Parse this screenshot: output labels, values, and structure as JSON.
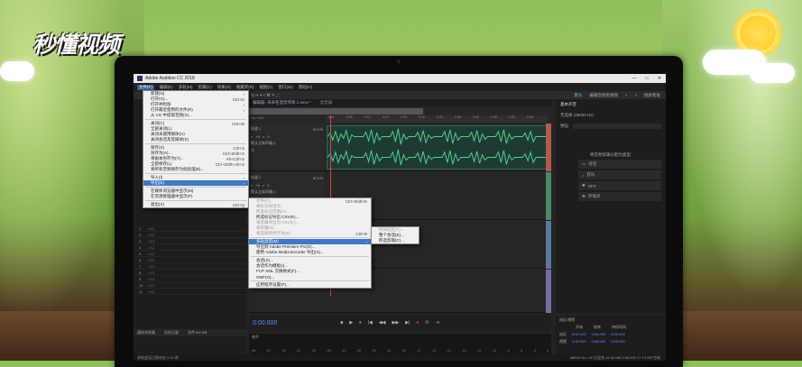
{
  "watermark": "秒懂视频",
  "window": {
    "title": "Adobe Audition CC 2018",
    "controls": [
      "—",
      "□",
      "✕"
    ]
  },
  "menubar": [
    "文件(F)",
    "编辑(E)",
    "多轨(M)",
    "剪辑(C)",
    "效果(S)",
    "收藏夹(R)",
    "视图(V)",
    "窗口(W)",
    "帮助(H)"
  ],
  "toolbar": {
    "workspace": "默认",
    "edit_audio": "编辑音频到视频",
    "more": "»",
    "search_placeholder": "搜索帮助"
  },
  "editor": {
    "tab": "编辑器: 未命名混音项目 1.sesx *",
    "mixer_tab": "混音器",
    "ruler_ticks": [
      "hms",
      "0:05",
      "0:10",
      "0:15",
      "0:20",
      "0:25",
      "0:30",
      "0:35",
      "0:40",
      "0:45",
      "0:50",
      "0:55"
    ],
    "ruler_label": "ms 0:00",
    "tracks": [
      {
        "name": "轨道 1",
        "vol": "+0",
        "pan": "0",
        "input": "默认立体声输入",
        "output": "主"
      },
      {
        "name": "轨道 2",
        "vol": "+0",
        "pan": "0",
        "input": "默认立体声输入",
        "output": "主"
      }
    ]
  },
  "transport": {
    "timecode": "0:00.000",
    "buttons": [
      "■",
      "▶",
      "⏸",
      "|◀",
      "◀◀",
      "▶▶",
      "▶|",
      "●",
      "⟳",
      "⇥"
    ]
  },
  "left_panel": {
    "rows": [
      "1",
      "2",
      "3",
      "4",
      "5",
      "6",
      "7",
      "8",
      "9",
      "10",
      "11"
    ],
    "media_browser": "媒体浏览器",
    "history": "历史记录",
    "file_count": "文件 0/0 KB"
  },
  "file_menu": {
    "items": [
      {
        "label": "新建(N)",
        "shortcut": "",
        "arrow": "›"
      },
      {
        "label": "打开(O)...",
        "shortcut": "Ctrl+O"
      },
      {
        "label": "打开并附加",
        "shortcut": "",
        "arrow": "›"
      },
      {
        "label": "打开最近使用的文件(R)",
        "shortcut": "",
        "arrow": "›"
      },
      {
        "label": "从 CD 中提取音频(X)...",
        "shortcut": ""
      },
      {
        "sep": true
      },
      {
        "label": "关闭(C)",
        "shortcut": "Ctrl+W"
      },
      {
        "label": "全部关闭(L)",
        "shortcut": ""
      },
      {
        "label": "关闭未使用媒体(U)",
        "shortcut": ""
      },
      {
        "label": "关闭会话及其媒体(S)",
        "shortcut": ""
      },
      {
        "sep": true
      },
      {
        "label": "保存(S)",
        "shortcut": "Ctrl+S"
      },
      {
        "label": "另存为(A)...",
        "shortcut": "Ctrl+Shift+S"
      },
      {
        "label": "将副本另存为(Y)...",
        "shortcut": "Alt+Ctrl+S"
      },
      {
        "label": "全部保存(L)",
        "shortcut": "Ctrl+Shift+Alt+S"
      },
      {
        "label": "将所有音频保存为批处理(B)...",
        "shortcut": ""
      },
      {
        "sep": true
      },
      {
        "label": "导入(I)",
        "shortcut": "",
        "arrow": "›"
      },
      {
        "label": "导出(E)",
        "shortcut": "",
        "arrow": "›",
        "selected": true
      },
      {
        "sep": true
      },
      {
        "label": "在媒体浏览器中显示(M)",
        "shortcut": ""
      },
      {
        "label": "在资源管理器中显示(P)",
        "shortcut": ""
      },
      {
        "sep": true
      },
      {
        "label": "退出(X)",
        "shortcut": "Ctrl+Q"
      }
    ]
  },
  "export_menu": {
    "items": [
      {
        "label": "文件(F)...",
        "shortcut": "Ctrl+Shift+E",
        "disabled": true
      },
      {
        "label": "将标记导出为...",
        "shortcut": "",
        "disabled": true
      },
      {
        "label": "所选标记范围(A)...",
        "shortcut": "",
        "disabled": true
      },
      {
        "label": "所选标记导出 CSV(K)...",
        "shortcut": ""
      },
      {
        "label": "将剪辑导出为 CSV(C)...",
        "shortcut": "",
        "disabled": true
      },
      {
        "label": "将剪辑(S)...",
        "shortcut": "",
        "disabled": true
      },
      {
        "label": "将选择项另存为(Z)...",
        "shortcut": "Ctrl+B",
        "disabled": true
      },
      {
        "sep": true
      },
      {
        "label": "多轨混音(M)",
        "shortcut": "",
        "arrow": "›",
        "selected": true
      },
      {
        "label": "导出到 Adobe Premiere Pro(X)...",
        "shortcut": ""
      },
      {
        "label": "使用 Adobe Media Encoder 导出(X)...",
        "shortcut": ""
      },
      {
        "sep": true
      },
      {
        "label": "会话(S)...",
        "shortcut": ""
      },
      {
        "label": "会话作为模板(I)...",
        "shortcut": ""
      },
      {
        "label": "FCP XML 交换格式(F)...",
        "shortcut": ""
      },
      {
        "label": "OMF(O)...",
        "shortcut": ""
      },
      {
        "sep": true
      },
      {
        "label": "应用程序设置(P)...",
        "shortcut": ""
      }
    ]
  },
  "mix_menu": {
    "items": [
      {
        "label": "时间选区(T)...",
        "disabled": true
      },
      {
        "label": "整个会话(E)...",
        "disabled": false
      },
      {
        "label": "所选剪辑(C)...",
        "disabled": false
      }
    ]
  },
  "right_panel": {
    "title": "基本声音",
    "sub": "无选择 (48000 Hz)",
    "preset_label": "预设:",
    "hint": "将音频剪辑分配为类型:",
    "types": [
      {
        "icon": "speech-icon",
        "label": "对话"
      },
      {
        "icon": "music-icon",
        "label": "音乐"
      },
      {
        "icon": "sfx-icon",
        "label": "SFX"
      },
      {
        "icon": "ambience-icon",
        "label": "环境声"
      }
    ]
  },
  "levels": {
    "title": "电平",
    "scale": [
      "dB",
      "-57",
      "-54",
      "-51",
      "-48",
      "-45",
      "-42",
      "-39",
      "-36",
      "-33",
      "-30",
      "-27",
      "-24",
      "-21",
      "-18",
      "-15",
      "-12",
      "-9",
      "-6",
      "-3",
      "0"
    ]
  },
  "selection_panel": {
    "title": "选区/视图",
    "headers": [
      "开始",
      "结束",
      "持续时间"
    ],
    "rows": [
      {
        "label": "选区",
        "start": "0:00.000",
        "end": "0:00.000",
        "dur": "0:00.000"
      },
      {
        "label": "视图",
        "start": "0:00.000",
        "end": "0:58.000",
        "dur": "0:58.000"
      }
    ]
  },
  "status": {
    "left": "多轨会话已保存在 0.01 秒",
    "right": "48000 Hz • 32 位混合  24.62 MB  0:58.000  17.74 GB 空闲"
  }
}
